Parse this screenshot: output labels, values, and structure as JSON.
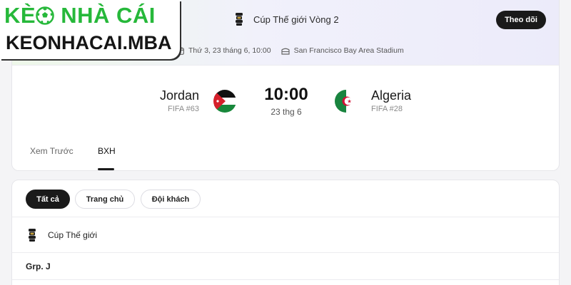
{
  "watermark": {
    "line1_prefix": "KÈ",
    "line1_suffix": " NHÀ CÁI",
    "line2": "KEONHACAI.MBA",
    "colors": {
      "green": "#26b83a",
      "dark": "#151515"
    }
  },
  "header": {
    "competition": "Cúp Thế giới Vòng 2",
    "follow_label": "Theo dõi",
    "date": "Thứ 3, 23 tháng 6, 10:00",
    "venue": "San Francisco Bay Area Stadium"
  },
  "match": {
    "home": {
      "name": "Jordan",
      "rank": "FIFA #63",
      "flag_icon": "jordan-flag-icon"
    },
    "away": {
      "name": "Algeria",
      "rank": "FIFA #28",
      "flag_icon": "algeria-flag-icon"
    },
    "time": "10:00",
    "date_short": "23 thg 6"
  },
  "tabs": [
    {
      "label": "Xem Trước",
      "active": false
    },
    {
      "label": "BXH",
      "active": true
    }
  ],
  "standings": {
    "filters": [
      {
        "label": "Tất cả",
        "active": true
      },
      {
        "label": "Trang chủ",
        "active": false
      },
      {
        "label": "Đội khách",
        "active": false
      }
    ],
    "league": "Cúp Thế giới",
    "group": "Grp. J"
  },
  "colors": {
    "accent_dark": "#1a1a1a",
    "banner_left": "#eef8e9",
    "banner_right": "#ecebfa"
  }
}
